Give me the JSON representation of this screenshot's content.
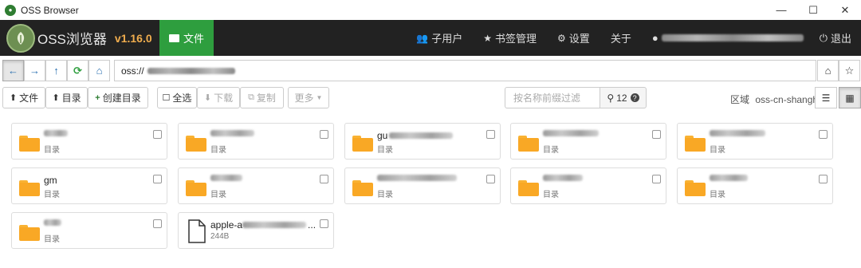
{
  "window": {
    "title": "OSS Browser",
    "controls": [
      "minimize",
      "maximize",
      "close"
    ]
  },
  "navbar": {
    "brand": "OSS浏览器",
    "version": "v1.16.0",
    "file_tab": "文件",
    "subusers": "子用户",
    "bookmarks": "书签管理",
    "settings": "设置",
    "about": "关于",
    "logout": "退出"
  },
  "address": {
    "value": "oss://"
  },
  "toolbar": {
    "upload_file": "文件",
    "upload_dir": "目录",
    "create_dir": "创建目录",
    "select_all": "全选",
    "download": "下载",
    "copy": "复制",
    "more": "更多",
    "search_placeholder": "按名称前缀过滤",
    "count": "12",
    "region_label": "区域",
    "region_value": "oss-cn-shanghai"
  },
  "items": [
    {
      "name": "",
      "sub": "目录",
      "type": "folder"
    },
    {
      "name": "",
      "sub": "目录",
      "type": "folder"
    },
    {
      "name": "gu",
      "sub": "目录",
      "type": "folder"
    },
    {
      "name": "",
      "sub": "目录",
      "type": "folder"
    },
    {
      "name": "",
      "sub": "目录",
      "type": "folder"
    },
    {
      "name": "gm",
      "sub": "目录",
      "type": "folder"
    },
    {
      "name": "",
      "sub": "目录",
      "type": "folder"
    },
    {
      "name": "",
      "sub": "目录",
      "type": "folder"
    },
    {
      "name": "",
      "sub": "目录",
      "type": "folder"
    },
    {
      "name": "",
      "sub": "目录",
      "type": "folder"
    },
    {
      "name": "",
      "sub": "目录",
      "type": "folder"
    },
    {
      "name": "apple-a",
      "sub": "244B",
      "type": "file"
    }
  ],
  "icons": {
    "folder_color": "#f9a825",
    "accent": "#2e9e3e",
    "version_color": "#f0ad4e"
  }
}
